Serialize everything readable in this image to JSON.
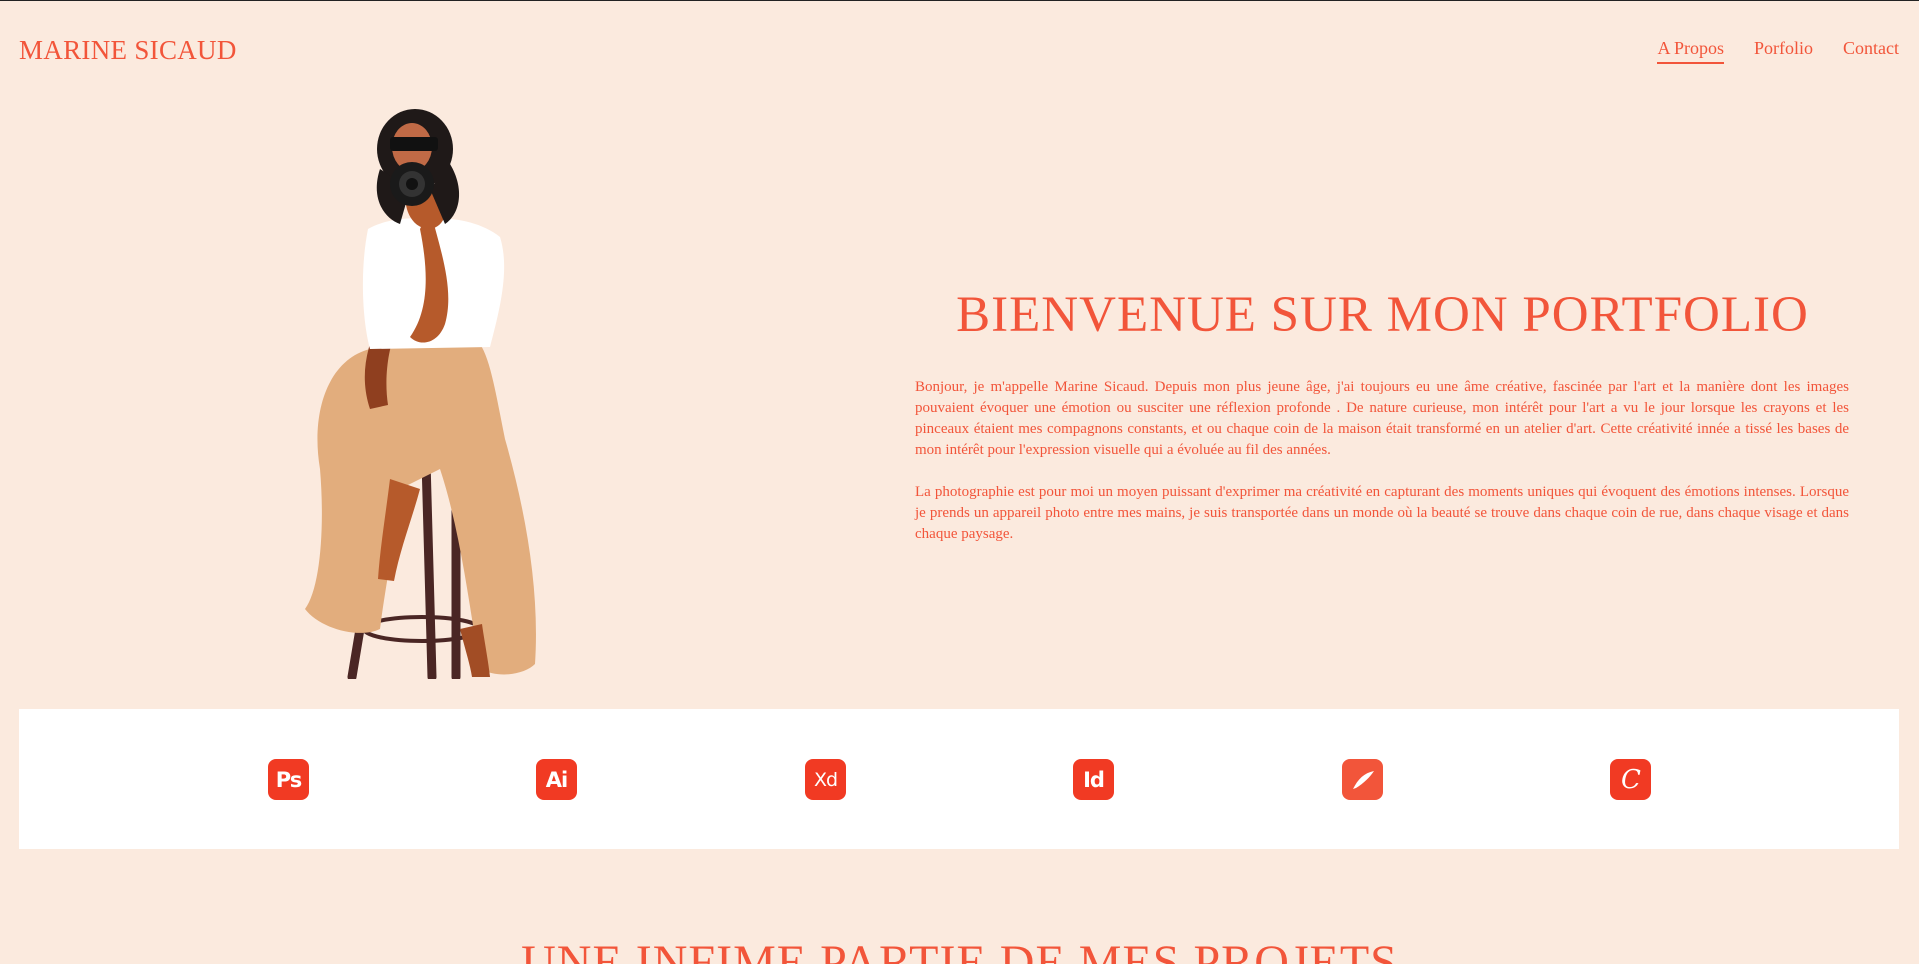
{
  "header": {
    "logo": "MARINE SICAUD",
    "nav": [
      {
        "label": "A Propos",
        "active": true
      },
      {
        "label": "Porfolio",
        "active": false
      },
      {
        "label": "Contact",
        "active": false
      }
    ]
  },
  "hero": {
    "title": "BIENVENUE SUR MON PORTFOLIO",
    "paragraphs": [
      "Bonjour, je m'appelle Marine Sicaud. Depuis mon plus jeune âge, j'ai toujours eu une âme créative, fascinée par l'art et la manière dont les images pouvaient évoquer une émotion ou susciter une réflexion profonde . De nature curieuse, mon intérêt pour l'art a vu le jour lorsque les crayons et les pinceaux étaient mes compagnons constants, et ou chaque coin de la maison était transformé en un atelier d'art. Cette créativité innée a tissé les bases de mon intérêt pour l'expression visuelle qui a évoluée au fil des années.",
      "La photographie est pour moi un moyen puissant d'exprimer ma créativité en capturant des moments uniques qui évoquent des émotions intenses. Lorsque je prends un appareil photo entre mes mains, je suis transportée dans un monde où la beauté se trouve dans chaque coin de rue, dans chaque visage et dans chaque paysage."
    ]
  },
  "tools": [
    {
      "label": "Ps",
      "icon": "photoshop-icon"
    },
    {
      "label": "Ai",
      "icon": "illustrator-icon"
    },
    {
      "label": "Xd",
      "icon": "xd-icon"
    },
    {
      "label": "Id",
      "icon": "indesign-icon"
    },
    {
      "label": "",
      "icon": "fresco-icon"
    },
    {
      "label": "C",
      "icon": "canva-icon"
    }
  ],
  "projects": {
    "title": "UNE INFIME PARTIE DE MES PROJETS"
  },
  "colors": {
    "background": "#fbeade",
    "accent": "#f2553a",
    "tool_icon": "#f13a23"
  }
}
